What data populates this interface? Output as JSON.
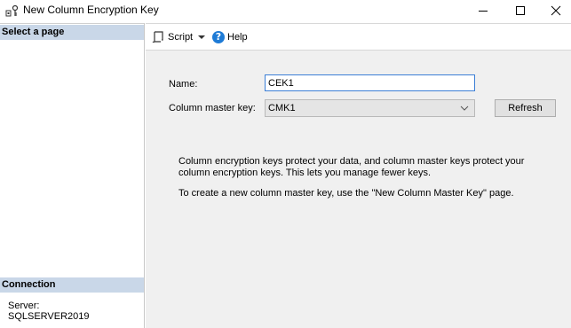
{
  "window": {
    "title": "New Column Encryption Key",
    "minimize_icon": "minimize-icon",
    "maximize_icon": "maximize-icon",
    "close_icon": "close-icon"
  },
  "left_pane": {
    "select_page_header": "Select a page",
    "connection_header": "Connection",
    "server_label": "Server:",
    "server_value": "SQLSERVER2019"
  },
  "toolbar": {
    "script_label": "Script",
    "help_label": "Help",
    "script_icon": "script-icon",
    "dropdown_icon": "chevron-down-icon",
    "help_icon": "help-icon"
  },
  "form": {
    "name_label": "Name:",
    "name_value": "CEK1",
    "cmk_label": "Column master key:",
    "cmk_selected": "CMK1",
    "refresh_label": "Refresh"
  },
  "description": {
    "paragraph1": "Column encryption keys protect your data, and column master keys protect your column encryption keys. This lets you manage fewer keys.",
    "paragraph2": "To create a new column master key, use the \"New Column Master Key\" page."
  },
  "colors": {
    "header_background": "#c9d7e8",
    "content_background": "#f0f0f0",
    "input_focus_border": "#3c7fd6",
    "help_icon": "#1e7bd6"
  }
}
